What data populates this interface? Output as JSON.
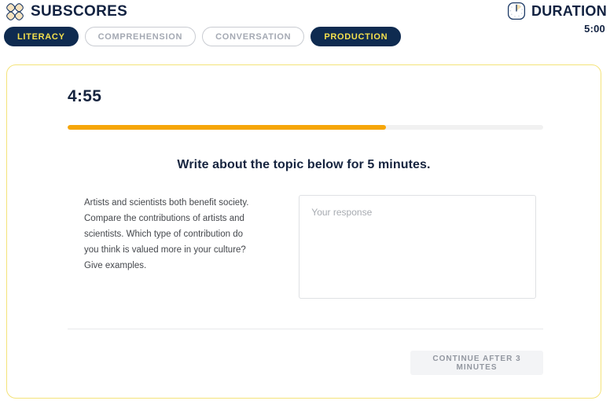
{
  "header": {
    "brand_title": "SUBSCORES",
    "brand_logo_icon": "four-petal-logo-icon",
    "duration_label": "DURATION",
    "duration_value": "5:00",
    "duration_icon": "clock-icon",
    "tabs": [
      {
        "label": "LITERACY",
        "state": "active"
      },
      {
        "label": "COMPREHENSION",
        "state": "inactive"
      },
      {
        "label": "CONVERSATION",
        "state": "inactive"
      },
      {
        "label": "PRODUCTION",
        "state": "active"
      }
    ]
  },
  "card": {
    "timer": "4:55",
    "progress_percent": 67,
    "instruction": "Write about the topic below for 5 minutes.",
    "prompt": "Artists and scientists both benefit society. Compare the contributions of artists and scientists. Which type of contribution do you think is valued more in your culture? Give examples.",
    "response_value": "",
    "response_placeholder": "Your response",
    "continue_label": "CONTINUE AFTER 3 MINUTES"
  },
  "colors": {
    "navy": "#0f2b50",
    "yellow": "#f4e04d",
    "orange": "#f6a609",
    "card_border": "#f4e37a",
    "muted": "#a4a9b3"
  }
}
